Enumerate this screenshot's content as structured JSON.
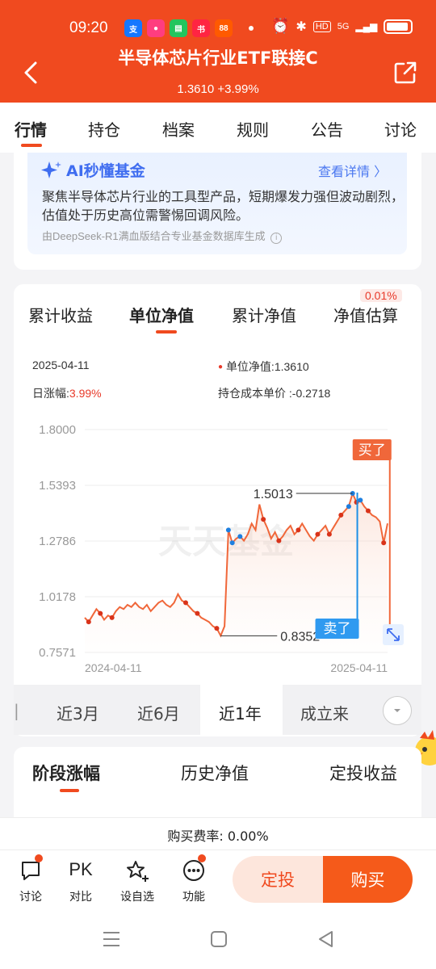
{
  "status_bar": {
    "time": "09:20",
    "network": "5G",
    "hd": "HD"
  },
  "header": {
    "title": "半导体芯片行业ETF联接C",
    "subtitle": "1.3610 +3.99%"
  },
  "tabs": [
    {
      "label": "行情",
      "active": true
    },
    {
      "label": "持仓"
    },
    {
      "label": "档案"
    },
    {
      "label": "规则"
    },
    {
      "label": "公告"
    },
    {
      "label": "讨论"
    }
  ],
  "ai_card": {
    "title": "AI秒懂基金",
    "more": "查看详情 〉",
    "text": "聚焦半导体芯片行业的工具型产品，短期爆发力强但波动剧烈，估值处于历史高位需警惕回调风险。",
    "source": "由DeepSeek-R1满血版结合专业基金数据库生成"
  },
  "chart_tabs": [
    {
      "label": "累计收益"
    },
    {
      "label": "单位净值",
      "active": true
    },
    {
      "label": "累计净值"
    },
    {
      "label": "净值估算"
    }
  ],
  "estimate_badge": "0.01%",
  "info": {
    "date": "2025-04-11",
    "nav_label": "单位净值:1.3610",
    "change_label": "日涨幅:",
    "change_value": "3.99%",
    "cost_label": "持仓成本单价 :-0.2718"
  },
  "chart_data": {
    "type": "line",
    "series": [
      {
        "values": [
          0.92,
          0.9,
          0.93,
          0.96,
          0.94,
          0.91,
          0.93,
          0.92,
          0.95,
          0.97,
          0.96,
          0.98,
          0.97,
          0.99,
          0.97,
          0.96,
          0.98,
          0.95,
          0.97,
          0.99,
          1.0,
          0.98,
          0.97,
          0.99,
          1.03,
          1.0,
          0.99,
          0.97,
          0.95,
          0.94,
          0.92,
          0.91,
          0.9,
          0.88,
          0.87,
          0.8352,
          0.88,
          1.33,
          1.27,
          1.29,
          1.3,
          1.28,
          1.31,
          1.36,
          1.33,
          1.45,
          1.38,
          1.34,
          1.29,
          1.32,
          1.28,
          1.3,
          1.33,
          1.35,
          1.31,
          1.33,
          1.36,
          1.33,
          1.3,
          1.28,
          1.31,
          1.33,
          1.35,
          1.31,
          1.34,
          1.37,
          1.4,
          1.42,
          1.44,
          1.5013,
          1.46,
          1.47,
          1.44,
          1.42,
          1.4,
          1.39,
          1.37,
          1.27,
          1.361
        ]
      }
    ],
    "x_ticks": [
      "2024-04-11",
      "2025-04-11"
    ],
    "y_ticks": [
      "1.8000",
      "1.5393",
      "1.2786",
      "1.0178",
      "0.7571"
    ],
    "ylim": [
      0.7571,
      1.8
    ],
    "max_label": "1.5013",
    "min_label": "0.8352",
    "buy_label": "买了",
    "sell_label": "卖了",
    "watermark": "天天基金",
    "color": "#f0673a"
  },
  "periods": [
    {
      "label": "近3月"
    },
    {
      "label": "近6月"
    },
    {
      "label": "近1年",
      "active": true
    },
    {
      "label": "成立来"
    }
  ],
  "bottom_tabs": [
    {
      "label": "阶段涨幅",
      "active": true
    },
    {
      "label": "历史净值"
    },
    {
      "label": "定投收益"
    }
  ],
  "fee": "购买费率: 0.00%",
  "actions": [
    {
      "label": "讨论",
      "icon": "comment-icon"
    },
    {
      "label": "对比",
      "icon": "pk-icon",
      "glyph": "PK"
    },
    {
      "label": "设自选",
      "icon": "star-icon"
    },
    {
      "label": "功能",
      "icon": "more-icon"
    }
  ],
  "buttons": {
    "auto_invest": "定投",
    "buy": "购买"
  }
}
